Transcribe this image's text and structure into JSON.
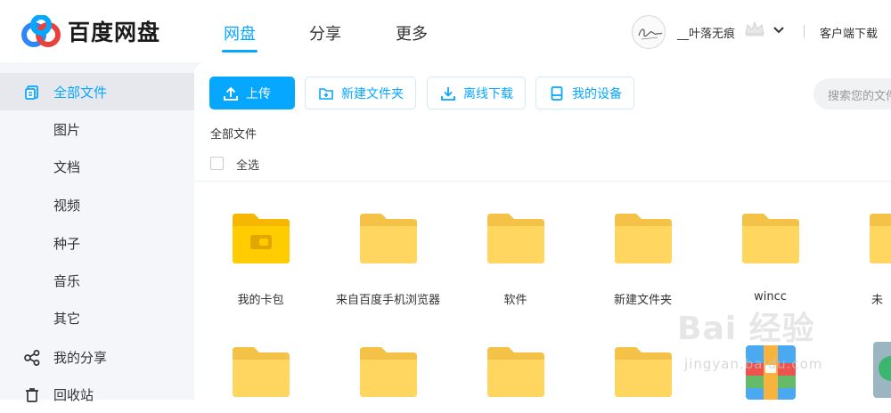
{
  "brand": {
    "name": "百度网盘",
    "accent": "#06a7ff"
  },
  "nav": {
    "tabs": [
      {
        "label": "网盘",
        "active": true
      },
      {
        "label": "分享"
      },
      {
        "label": "更多"
      }
    ]
  },
  "user": {
    "name": "__叶落无痕",
    "client_download": "客户端下载"
  },
  "sidebar": {
    "items": [
      {
        "label": "全部文件",
        "icon": "files-icon",
        "active": true
      },
      {
        "label": "图片"
      },
      {
        "label": "文档"
      },
      {
        "label": "视频"
      },
      {
        "label": "种子"
      },
      {
        "label": "音乐"
      },
      {
        "label": "其它"
      },
      {
        "label": "我的分享",
        "icon": "share-icon"
      },
      {
        "label": "回收站",
        "icon": "trash-icon"
      }
    ]
  },
  "toolbar": {
    "upload": "上传",
    "new_folder": "新建文件夹",
    "offline_download": "离线下载",
    "my_devices": "我的设备",
    "search_placeholder": "搜索您的文件"
  },
  "breadcrumb": "全部文件",
  "select_all": "全选",
  "files": [
    {
      "name": "我的卡包",
      "type": "wallet-folder"
    },
    {
      "name": "来自百度手机浏览器",
      "type": "folder"
    },
    {
      "name": "软件",
      "type": "folder"
    },
    {
      "name": "新建文件夹",
      "type": "folder"
    },
    {
      "name": "wincc",
      "type": "folder"
    },
    {
      "name": "未",
      "type": "folder"
    }
  ],
  "watermark": {
    "main": "Bai 经验",
    "sub": "jingyan.baidu.com"
  }
}
